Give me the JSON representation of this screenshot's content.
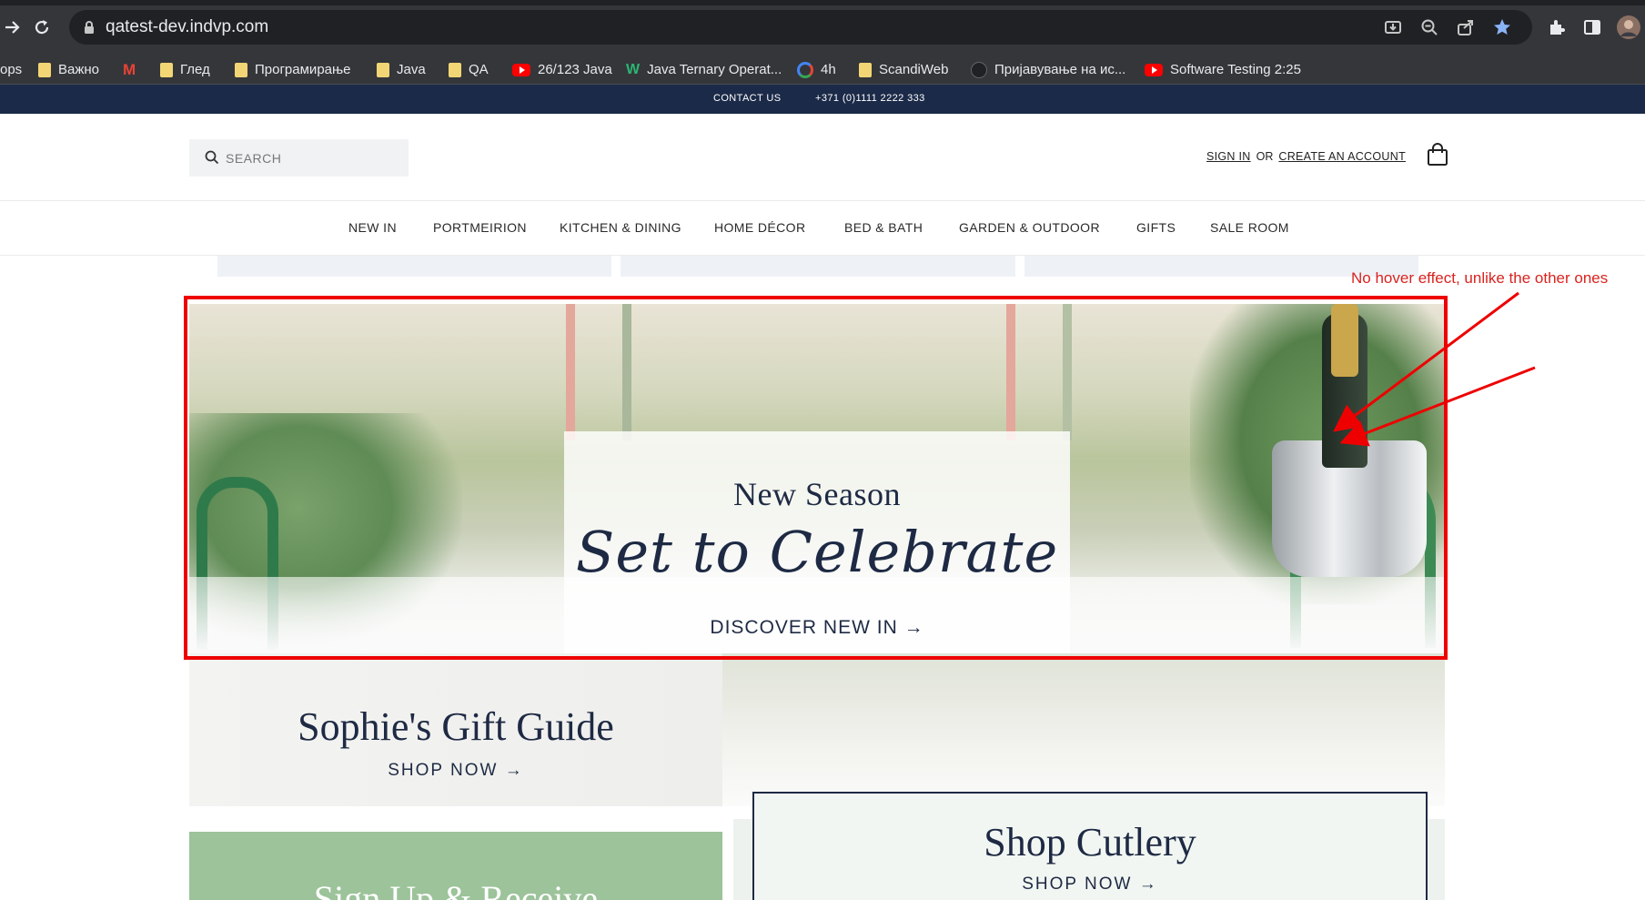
{
  "browser": {
    "url": "qatest-dev.indvp.com",
    "bookmarks": [
      {
        "label": "ops",
        "icon": "none"
      },
      {
        "label": "Важно",
        "icon": "folder-icon"
      },
      {
        "label": "",
        "icon": "gmail-icon"
      },
      {
        "label": "Глед",
        "icon": "folder-icon"
      },
      {
        "label": "Програмирање",
        "icon": "folder-icon"
      },
      {
        "label": "Java",
        "icon": "folder-icon"
      },
      {
        "label": "QA",
        "icon": "folder-icon"
      },
      {
        "label": "26/123 Java",
        "icon": "youtube-icon"
      },
      {
        "label": "Java Ternary Operat...",
        "icon": "w-icon"
      },
      {
        "label": "4h",
        "icon": "google-icon"
      },
      {
        "label": "ScandiWeb",
        "icon": "folder-icon"
      },
      {
        "label": "Пријавување на ис...",
        "icon": "circle-icon"
      },
      {
        "label": "Software Testing 2:25",
        "icon": "youtube-icon"
      }
    ]
  },
  "topbar": {
    "contact": "CONTACT US",
    "phone": "+371 (0)1111 2222 333"
  },
  "header": {
    "search_placeholder": "SEARCH",
    "sign_in": "SIGN IN",
    "or": "OR",
    "create_account": "CREATE AN ACCOUNT"
  },
  "nav": {
    "items": [
      "NEW IN",
      "PORTMEIRION",
      "KITCHEN & DINING",
      "HOME DÉCOR",
      "BED & BATH",
      "GARDEN & OUTDOOR",
      "GIFTS",
      "SALE ROOM"
    ]
  },
  "hero": {
    "kicker": "New Season",
    "title": "Set to Celebrate",
    "link": "DISCOVER NEW IN →"
  },
  "annotation": {
    "text": "No hover effect, unlike the other ones",
    "color": "#d9231f"
  },
  "tiles": {
    "gift_title": "Sophie's Gift Guide",
    "gift_link": "SHOP NOW →",
    "signup_title": "Sign Up & Receive",
    "cutlery_title": "Shop Cutlery",
    "cutlery_link": "SHOP NOW →"
  },
  "colors": {
    "navy": "#1b2a48",
    "accent_green": "#9cc39a",
    "star_blue": "#8ab4f8"
  }
}
